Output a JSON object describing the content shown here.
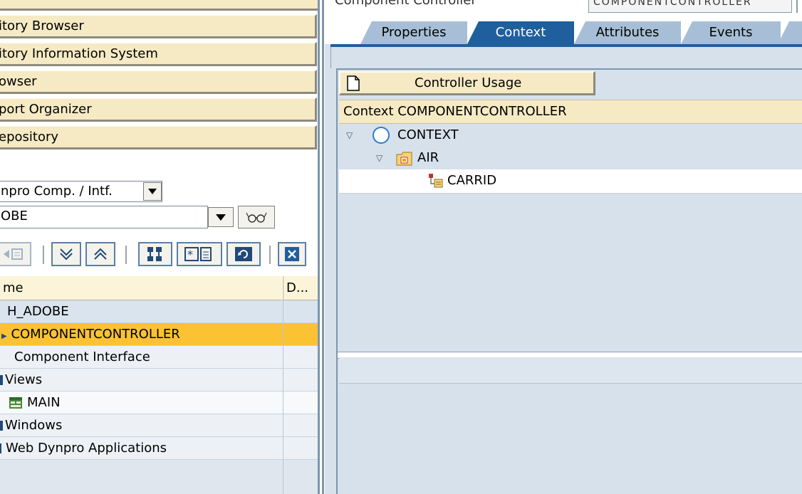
{
  "left": {
    "nav_buttons": [
      "itory Browser",
      "itory Information System",
      "owser",
      "port Organizer",
      "epository"
    ],
    "object_type_select": "npro Comp. / Intf.",
    "object_name_input": "OBE",
    "tree_grid": {
      "columns": [
        "me",
        "D..."
      ],
      "rows": [
        {
          "label": "H_ADOBE",
          "icon": "none"
        },
        {
          "label": "COMPONENTCONTROLLER",
          "icon": "node-arrow-icon",
          "selected": true
        },
        {
          "label": "Component Interface",
          "icon": "none"
        },
        {
          "label": "Views",
          "icon": "folder-icon"
        },
        {
          "label": "MAIN",
          "icon": "view-icon"
        },
        {
          "label": "Windows",
          "icon": "folder-icon"
        },
        {
          "label": "Web Dynpro Applications",
          "icon": "folder-icon"
        }
      ]
    }
  },
  "right": {
    "top_label": "Component Controller",
    "top_field": "COMPONENTCONTROLLER",
    "tabs": [
      "Properties",
      "Context",
      "Attributes",
      "Events"
    ],
    "active_tab": "Context",
    "controller_usage_button": "Controller Usage",
    "context_header": "Context COMPONENTCONTROLLER",
    "context_tree": [
      {
        "label": "CONTEXT",
        "icon": "context-root-icon",
        "level": 0
      },
      {
        "label": "AIR",
        "icon": "node-folder-icon",
        "level": 1
      },
      {
        "label": "CARRID",
        "icon": "attribute-icon",
        "level": 2
      }
    ]
  },
  "colors": {
    "selected_row": "#fbc233",
    "tab_active": "#1f5f9d",
    "tab_inactive": "#a7bfd6",
    "button_face": "#f5eac4",
    "panel_bg": "#d6e1ec"
  }
}
